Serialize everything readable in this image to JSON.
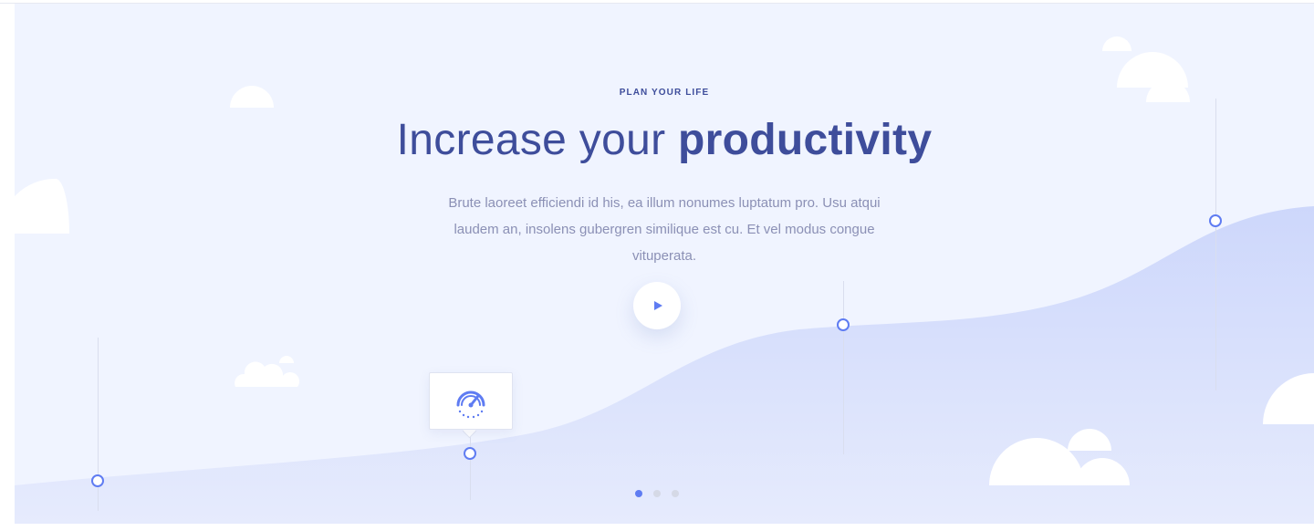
{
  "hero": {
    "eyebrow": "PLAN YOUR LIFE",
    "headline_light": "Increase your",
    "headline_bold": "productivity",
    "description": "Brute laoreet efficiendi id his, ea illum nonumes luptatum pro. Usu atqui laudem an, insolens gubergren similique est cu. Et vel modus congue vituperata."
  },
  "colors": {
    "accent": "#5f7cf2",
    "heading": "#3e4d9b",
    "body_text": "#8b90b5",
    "background": "#f0f4ff",
    "wave": "#cfd9fb"
  },
  "icons": {
    "play": "play-icon",
    "card": "speedometer-icon"
  },
  "slider": {
    "total_slides": 3,
    "active_index": 0
  }
}
